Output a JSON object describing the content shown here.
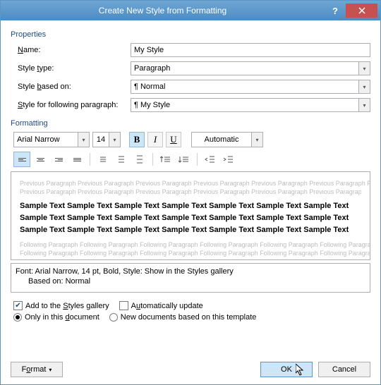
{
  "title": "Create New Style from Formatting",
  "sections": {
    "properties": "Properties",
    "formatting": "Formatting"
  },
  "props": {
    "name_label": "Name:",
    "name_value": "My Style",
    "type_label": "Style type:",
    "type_value": "Paragraph",
    "based_label": "Style based on:",
    "based_value": "Normal",
    "following_label": "Style for following paragraph:",
    "following_value": "My Style"
  },
  "format": {
    "font": "Arial Narrow",
    "size": "14",
    "bold": "B",
    "italic": "I",
    "underline": "U",
    "color": "Automatic"
  },
  "preview": {
    "ghost_prev": "Previous Paragraph Previous Paragraph Previous Paragraph Previous Paragraph Previous Paragraph Previous Paragraph Previous Paragraph Previous Paragraph Previous Paragraph",
    "sample": "Sample Text Sample Text Sample Text Sample Text Sample Text Sample Text Sample Text Sample Text Sample Text Sample Text Sample Text Sample Text Sample Text Sample Text Sample Text Sample Text Sample Text Sample Text Sample Text Sample Text Sample Text",
    "ghost_next": "Following Paragraph Following Paragraph Following Paragraph Following Paragraph Following Paragraph Following Paragraph Following Paragraph Following Paragraph Following Paragraph"
  },
  "desc": {
    "line1": "Font: Arial Narrow, 14 pt, Bold, Style: Show in the Styles gallery",
    "line2": "Based on: Normal"
  },
  "checks": {
    "add_gallery": "Add to the Styles gallery",
    "auto_update": "Automatically update",
    "only_doc": "Only in this document",
    "new_docs": "New documents based on this template"
  },
  "buttons": {
    "format": "Format",
    "ok": "OK",
    "cancel": "Cancel"
  }
}
